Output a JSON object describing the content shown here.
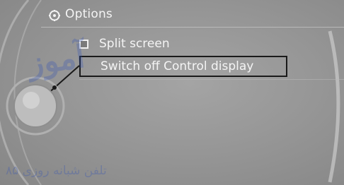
{
  "header": {
    "title": "Options",
    "icon": "options-gear-icon"
  },
  "menu": {
    "items": [
      {
        "label": "Split screen",
        "has_checkbox": true,
        "checked": false
      },
      {
        "label": "Switch off Control display",
        "has_checkbox": false,
        "selected": true
      }
    ]
  },
  "watermark": {
    "logo_text": "آموز",
    "footer_text": "تلفن شبانه روزی ۸۵"
  },
  "colors": {
    "background": "#979797",
    "text": "#f4f4f4",
    "selection_frame": "#1a1a1a",
    "watermark": "#2f50b8"
  }
}
